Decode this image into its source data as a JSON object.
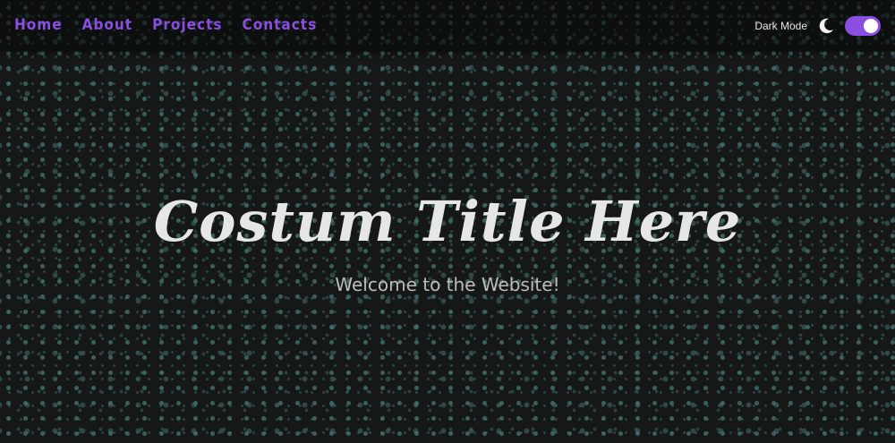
{
  "nav": {
    "links": [
      "Home",
      "About",
      "Projects",
      "Contacts"
    ],
    "mode_label": "Dark Mode",
    "mode_icon": "moon-icon",
    "dark_mode_enabled": true,
    "accent_color": "#8a4fe0"
  },
  "hero": {
    "title": "Costum Title Here",
    "subtitle": "Welcome to the Website!"
  }
}
